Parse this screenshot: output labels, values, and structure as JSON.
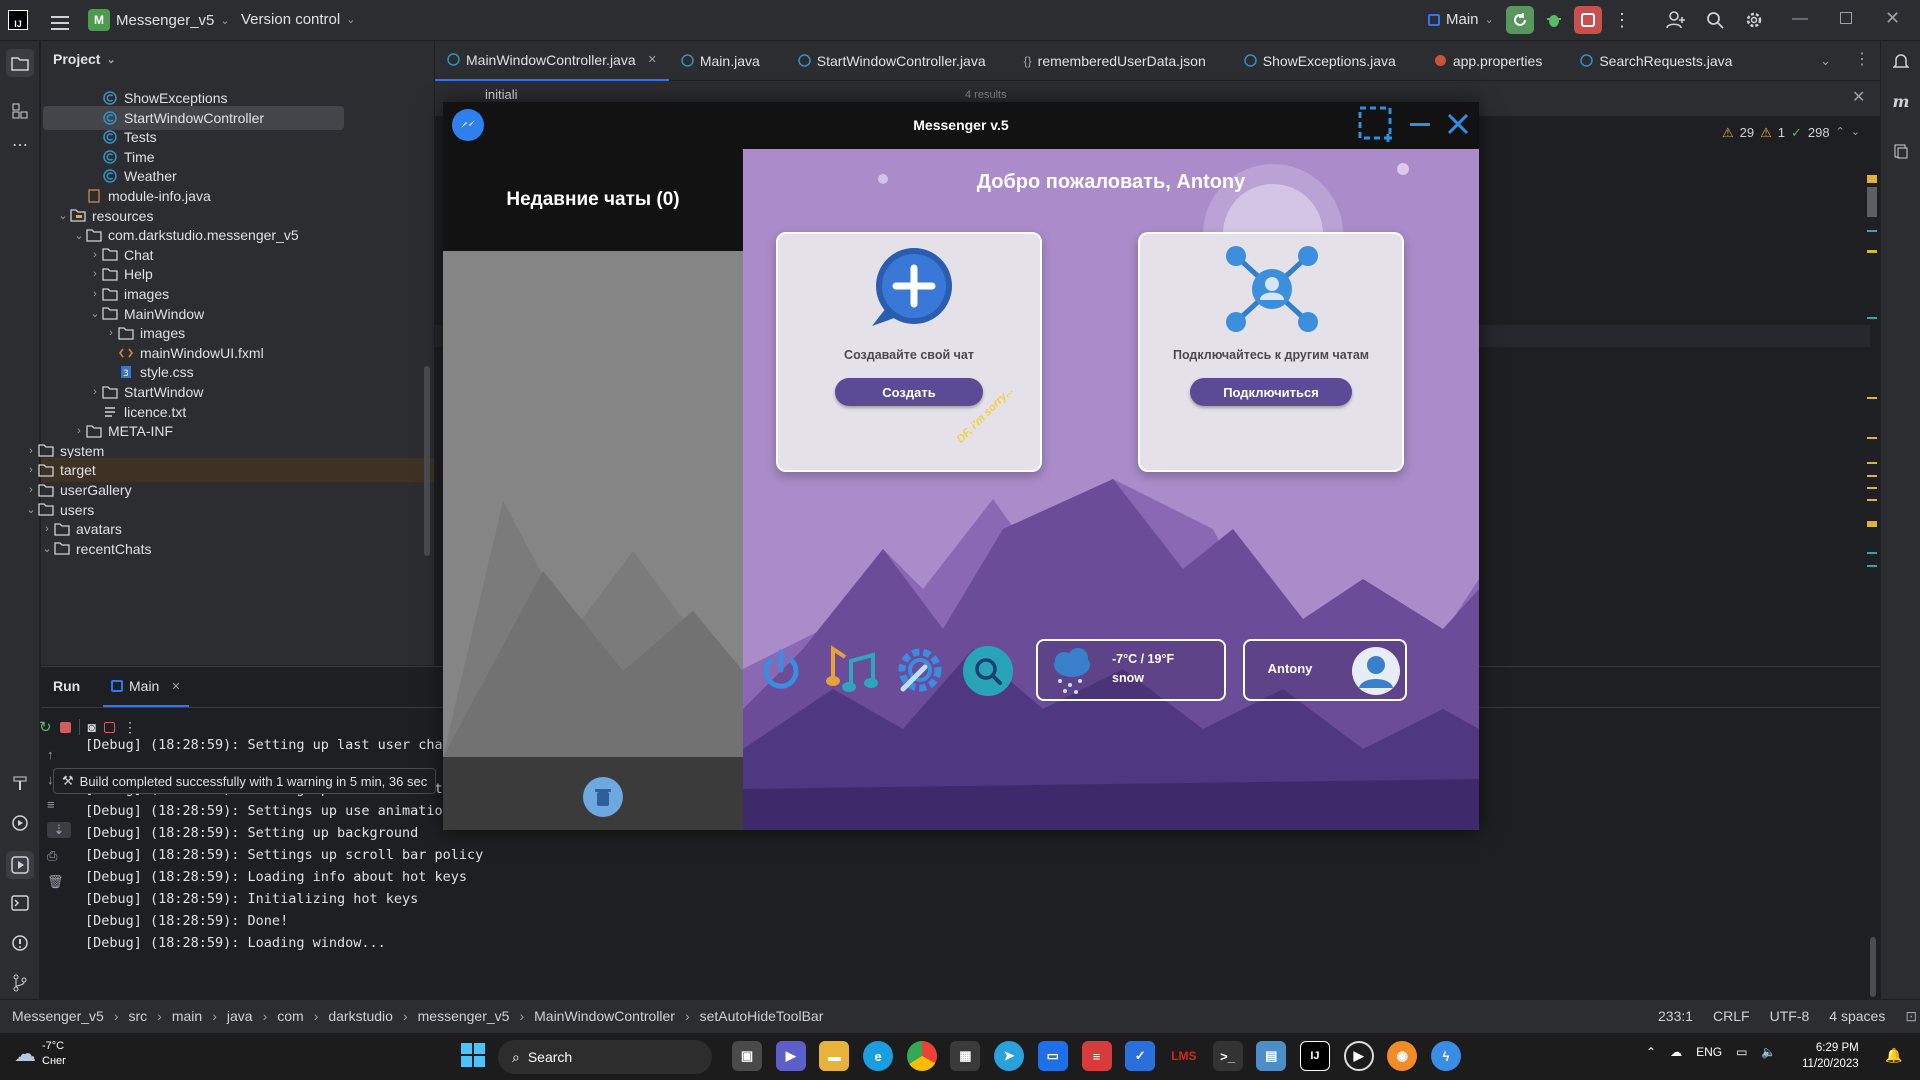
{
  "titlebar": {
    "project_letter": "M",
    "project_name": "Messenger_v5",
    "vcs": "Version control",
    "run_config": "Main"
  },
  "project_panel": {
    "title": "Project",
    "items": [
      {
        "label": "ShowExceptions"
      },
      {
        "label": "StartWindowController"
      },
      {
        "label": "Tests"
      },
      {
        "label": "Time"
      },
      {
        "label": "Weather"
      },
      {
        "label": "module-info.java"
      },
      {
        "label": "resources"
      },
      {
        "label": "com.darkstudio.messenger_v5"
      },
      {
        "label": "Chat"
      },
      {
        "label": "Help"
      },
      {
        "label": "images"
      },
      {
        "label": "MainWindow"
      },
      {
        "label": "images"
      },
      {
        "label": "mainWindowUI.fxml"
      },
      {
        "label": "style.css"
      },
      {
        "label": "StartWindow"
      },
      {
        "label": "licence.txt"
      },
      {
        "label": "META-INF"
      },
      {
        "label": "system"
      },
      {
        "label": "target"
      },
      {
        "label": "userGallery"
      },
      {
        "label": "users"
      },
      {
        "label": "avatars"
      },
      {
        "label": "recentChats"
      }
    ]
  },
  "tabs": [
    {
      "label": "MainWindowController.java"
    },
    {
      "label": "Main.java"
    },
    {
      "label": "StartWindowController.java"
    },
    {
      "label": "rememberedUserData.json"
    },
    {
      "label": "ShowExceptions.java"
    },
    {
      "label": "app.properties"
    },
    {
      "label": "SearchRequests.java"
    }
  ],
  "editor": {
    "search_value": "initiali",
    "results": "4 results",
    "warnings": "29",
    "weak_warnings": "1",
    "ok_count": "298"
  },
  "run_panel": {
    "title": "Run",
    "tab": "Main",
    "tooltip": "Build completed successfully with 1 warning in 5 min, 36 sec",
    "log": [
      "[Debug] (18:28:59): Setting up last user chat",
      "[Debug] (18:28:59): Setting up elements on to",
      "[Debug] (18:28:59): Settings up use animations variable",
      "[Debug] (18:28:59): Setting up background",
      "[Debug] (18:28:59): Settings up scroll bar policy",
      "[Debug] (18:28:59): Loading info about hot keys",
      "[Debug] (18:28:59): Initializing hot keys",
      "[Debug] (18:28:59): Done!",
      "[Debug] (18:28:59): Loading window..."
    ]
  },
  "statusbar": {
    "breadcrumbs": [
      "Messenger_v5",
      "src",
      "main",
      "java",
      "com",
      "darkstudio",
      "messenger_v5",
      "MainWindowController",
      "setAutoHideToolBar"
    ],
    "position": "233:1",
    "line_sep": "CRLF",
    "encoding": "UTF-8",
    "indent": "4 spaces"
  },
  "messenger": {
    "title": "Messenger v.5",
    "recent_chats": "Недавние чаты (0)",
    "welcome": "Добро пожаловать, Antony",
    "create_card": {
      "text": "Создавайте свой чат",
      "button": "Создать"
    },
    "connect_card": {
      "text": "Подключайтесь к другим чатам",
      "button": "Подключиться"
    },
    "sticker": "DF, i'm sorry...",
    "weather": {
      "temp": "-7°C / 19°F",
      "condition": "snow"
    },
    "user": {
      "name": "Antony"
    }
  },
  "taskbar": {
    "weather_temp": "-7°C",
    "weather_cond": "Снег",
    "search_placeholder": "Search",
    "lang": "ENG",
    "time": "6:29 PM",
    "date": "11/20/2023"
  },
  "colors": {
    "ide_bg": "#1e1f22",
    "ide_panel": "#2b2d30",
    "accent": "#3574f0",
    "messenger_purple": "#a88ac9",
    "button_purple": "#5b4b96"
  }
}
